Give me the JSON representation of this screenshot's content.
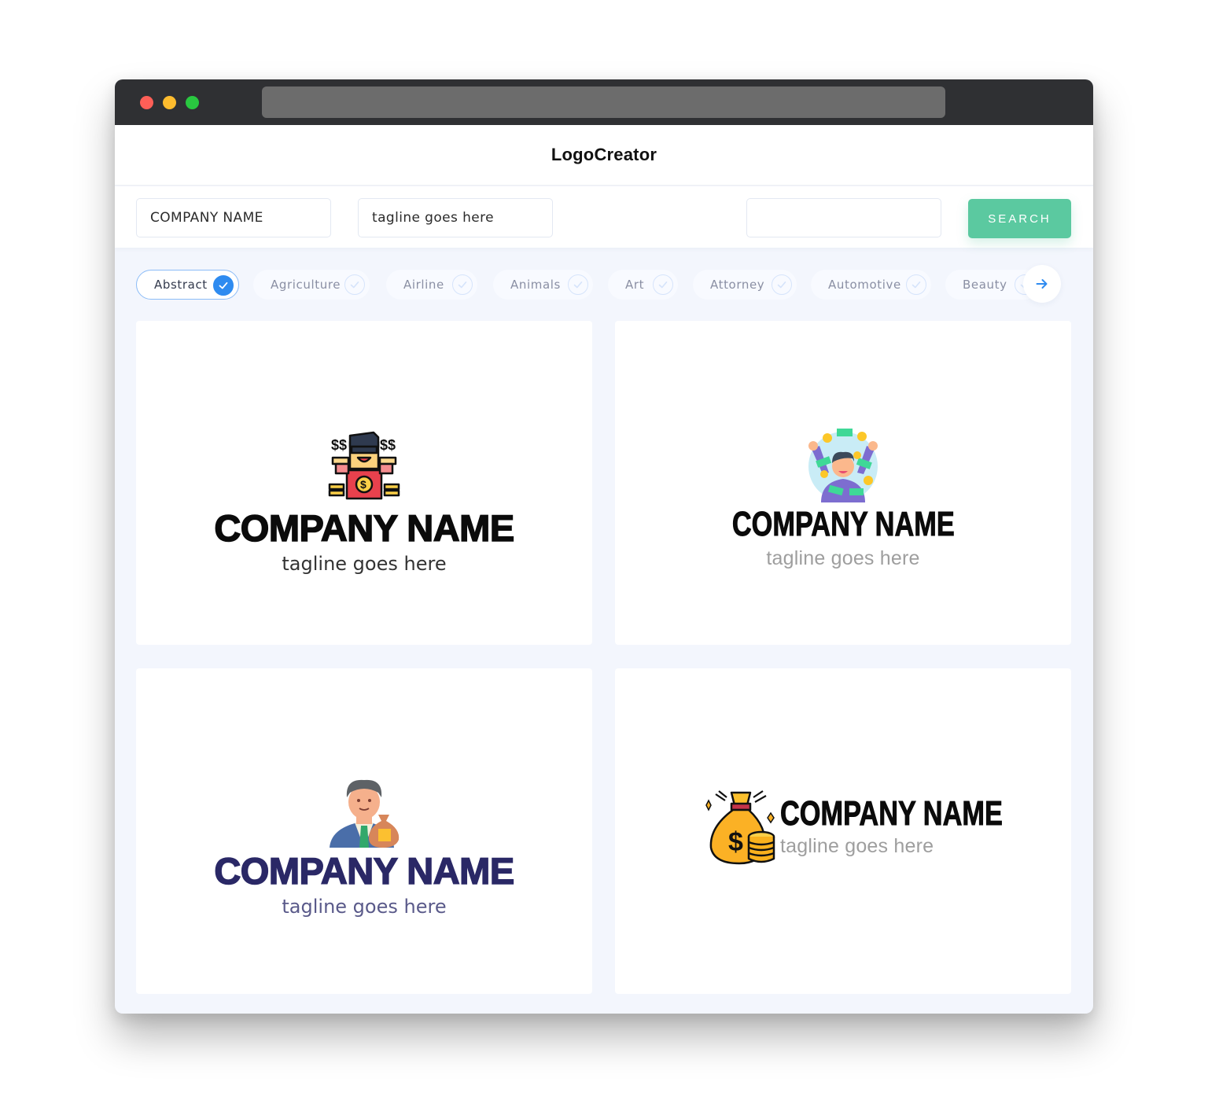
{
  "app": {
    "title": "LogoCreator"
  },
  "search": {
    "company_value": "COMPANY NAME",
    "tagline_value": "tagline goes here",
    "extra_value": "",
    "button_label": "SEARCH"
  },
  "categories": {
    "items": [
      {
        "label": "Abstract",
        "selected": true
      },
      {
        "label": "Agriculture",
        "selected": false
      },
      {
        "label": "Airline",
        "selected": false
      },
      {
        "label": "Animals",
        "selected": false
      },
      {
        "label": "Art",
        "selected": false
      },
      {
        "label": "Attorney",
        "selected": false
      },
      {
        "label": "Automotive",
        "selected": false
      },
      {
        "label": "Beauty",
        "selected": false
      }
    ],
    "next_icon": "arrow-right-icon"
  },
  "colors": {
    "accent_green": "#5bc9a0",
    "accent_blue": "#2e8bf0",
    "navy_text": "#2a2866"
  },
  "logos": [
    {
      "icon": "rich-man-sunglasses-icon",
      "company": "COMPANY NAME",
      "tagline": "tagline goes here"
    },
    {
      "icon": "man-money-rain-icon",
      "company": "COMPANY NAME",
      "tagline": "tagline goes here"
    },
    {
      "icon": "businessman-money-bag-icon",
      "company": "COMPANY NAME",
      "tagline": "tagline goes here"
    },
    {
      "icon": "money-bag-coins-icon",
      "company": "COMPANY NAME",
      "tagline": "tagline goes here"
    }
  ]
}
